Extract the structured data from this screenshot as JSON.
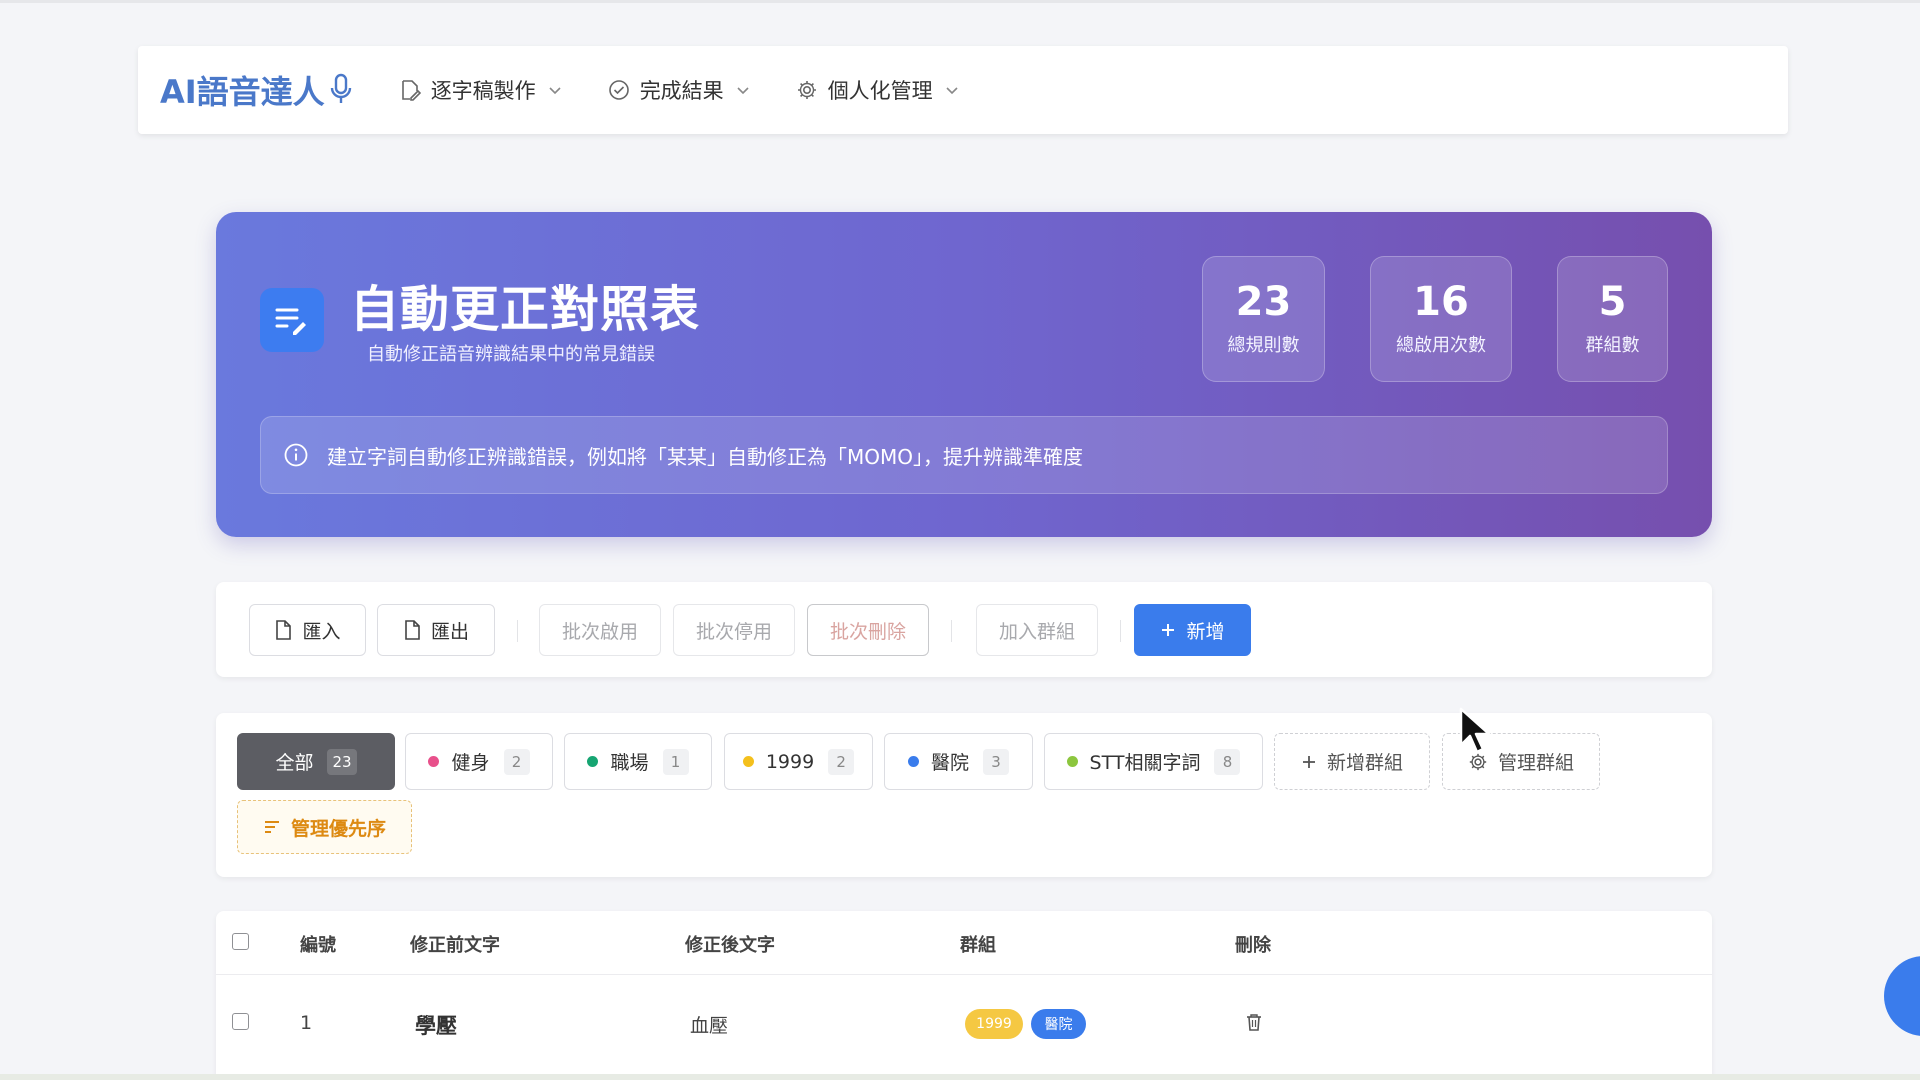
{
  "nav": {
    "brand": "AI語音達人",
    "items": [
      {
        "label": "逐字稿製作",
        "icon": "edit-file-icon"
      },
      {
        "label": "完成結果",
        "icon": "check-circle-icon"
      },
      {
        "label": "個人化管理",
        "icon": "gear-icon"
      }
    ]
  },
  "hero": {
    "title": "自動更正對照表",
    "subtitle": "自動修正語音辨識結果中的常見錯誤",
    "stats": [
      {
        "value": "23",
        "label": "總規則數"
      },
      {
        "value": "16",
        "label": "總啟用次數"
      },
      {
        "value": "5",
        "label": "群組數"
      }
    ],
    "info": "建立字詞自動修正辨識錯誤，例如將「某某」自動修正為「MOMO」，提升辨識準確度"
  },
  "toolbar": {
    "import_label": "匯入",
    "export_label": "匯出",
    "batch_enable_label": "批次啟用",
    "batch_disable_label": "批次停用",
    "batch_delete_label": "批次刪除",
    "add_to_group_label": "加入群組",
    "add_label": "新增"
  },
  "filters": {
    "all": {
      "label": "全部",
      "count": "23"
    },
    "groups": [
      {
        "label": "健身",
        "count": "2",
        "color": "#e8508b"
      },
      {
        "label": "職場",
        "count": "1",
        "color": "#16a572"
      },
      {
        "label": "1999",
        "count": "2",
        "color": "#f4c01c"
      },
      {
        "label": "醫院",
        "count": "3",
        "color": "#3a7cec"
      },
      {
        "label": "STT相關字詞",
        "count": "8",
        "color": "#8cc63e"
      }
    ],
    "add_group_label": "新增群組",
    "manage_group_label": "管理群組",
    "manage_priority_label": "管理優先序"
  },
  "table": {
    "headers": {
      "id": "編號",
      "before": "修正前文字",
      "after": "修正後文字",
      "group": "群組",
      "delete": "刪除"
    },
    "rows": [
      {
        "id": "1",
        "before": "學壓",
        "after": "血壓",
        "tags": [
          "1999",
          "醫院"
        ]
      }
    ]
  },
  "colors": {
    "primary": "#3a7cec",
    "hero_start": "#6a79dd",
    "hero_end": "#764fae",
    "priority": "#dd8a12"
  }
}
